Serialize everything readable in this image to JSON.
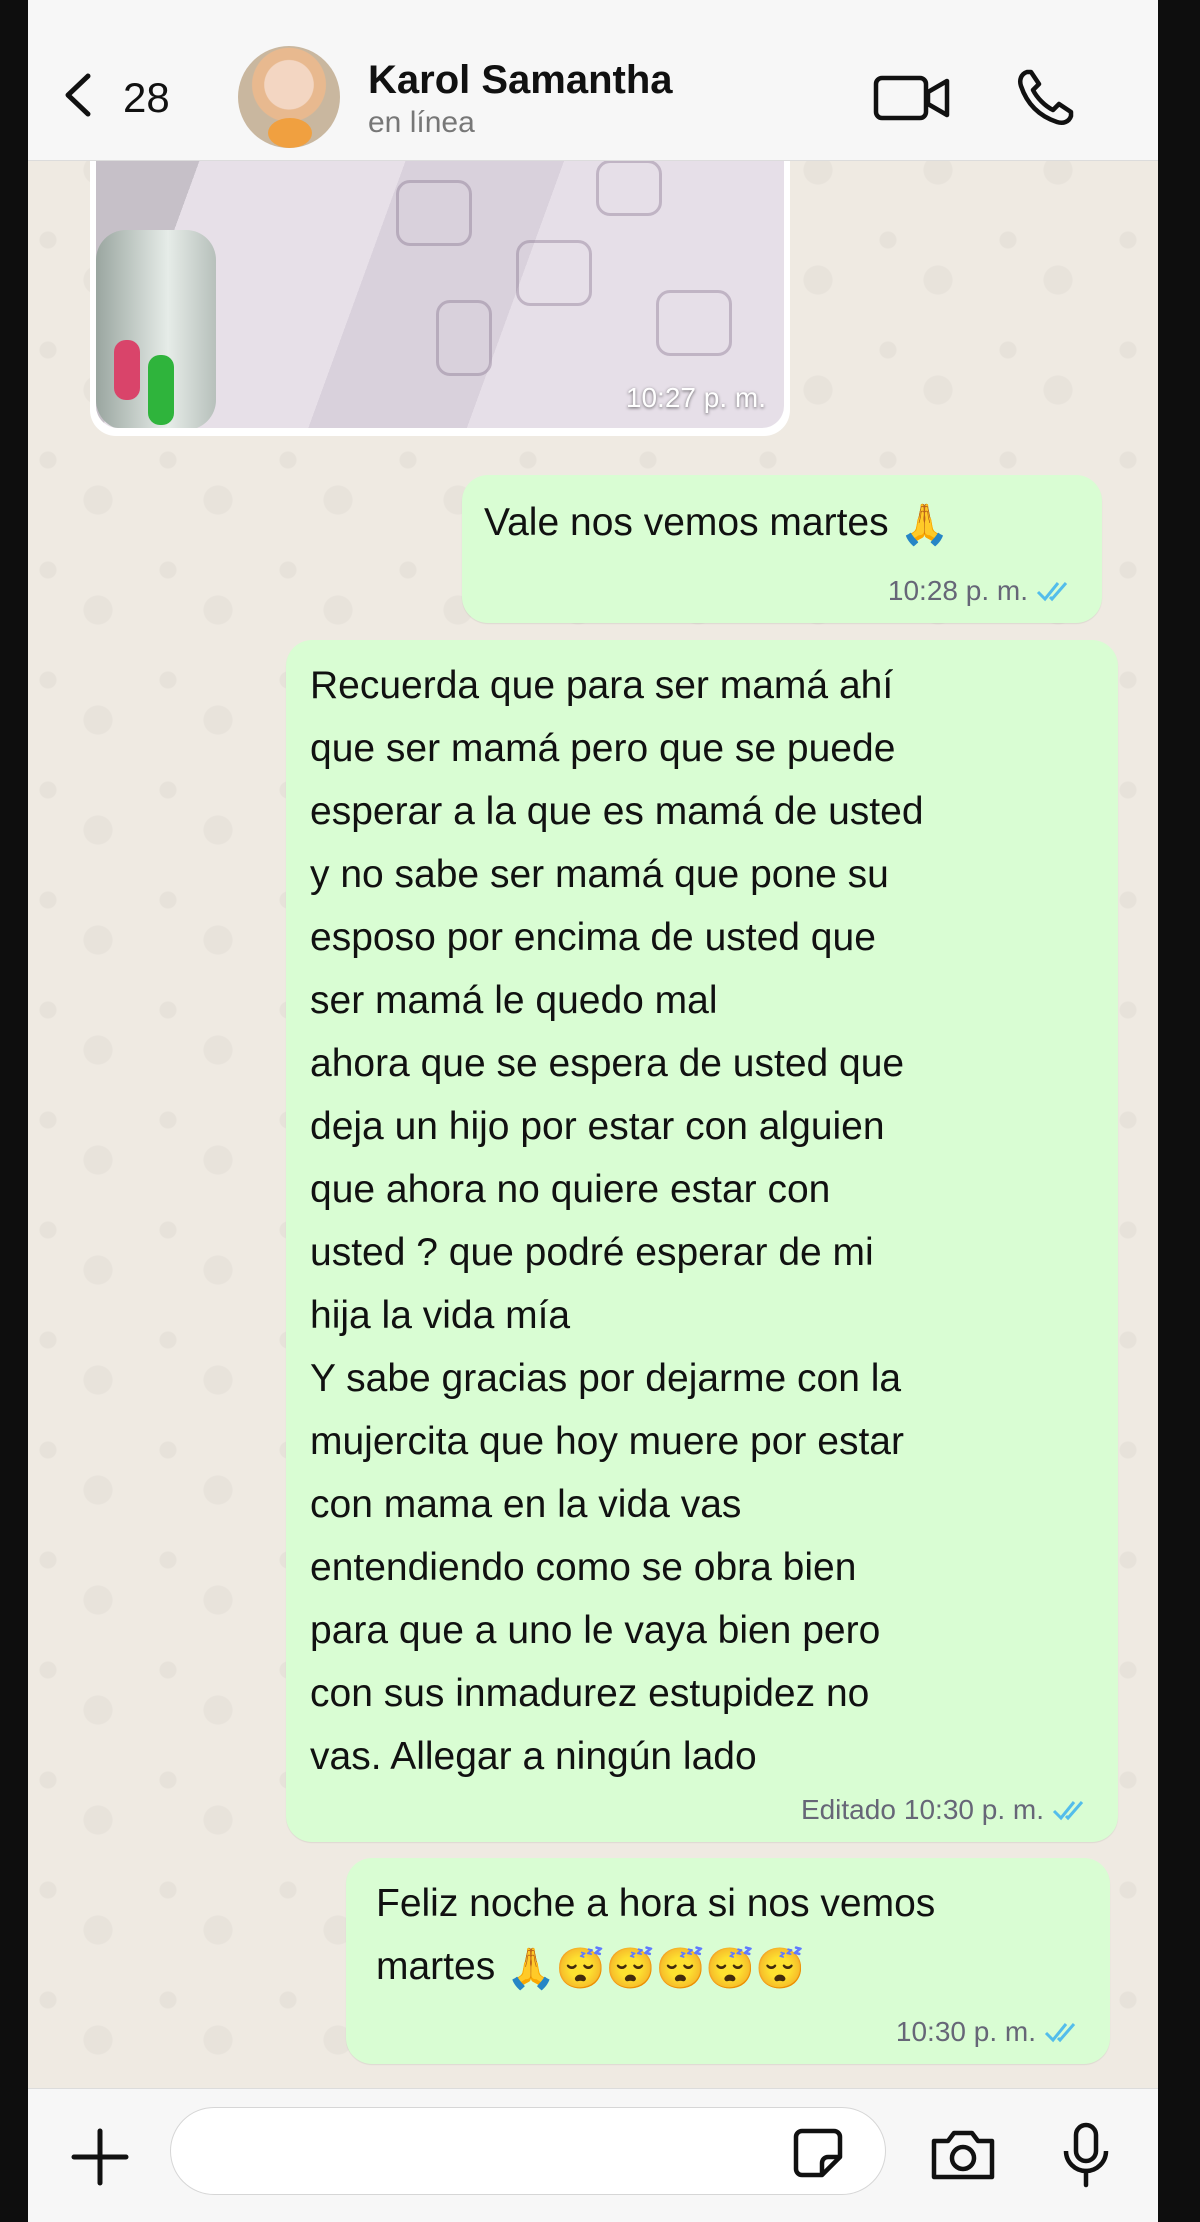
{
  "header": {
    "unread_count": "28",
    "contact_name": "Karol Samantha",
    "contact_status": "en línea"
  },
  "messages": [
    {
      "type": "image",
      "direction": "incoming",
      "time": "10:27 p. m."
    },
    {
      "type": "text",
      "direction": "outgoing",
      "text": "Vale nos vemos martes",
      "emojis": "🙏",
      "time": "10:28 p. m.",
      "status": "read"
    },
    {
      "type": "text",
      "direction": "outgoing",
      "text": "Recuerda que para ser mamá ahí\nque ser mamá pero que se puede\nesperar a la que es mamá de usted\ny no sabe ser mamá que pone su\nesposo por encima de usted que\nser mamá  le quedo mal\nahora que se espera de  usted que\ndeja un hijo por estar con alguien\nque ahora no quiere estar con\nusted ? que podré esperar de mi\nhija la vida mía\nY sabe gracias por dejarme con la\nmujercita que hoy muere por estar\ncon mama en la vida vas\nentendiendo como se obra bien\npara que a uno le vaya bien pero\ncon sus inmadurez estupidez no\nvas. Allegar a ningún lado",
      "edited_label": "Editado",
      "time": "10:30 p. m.",
      "status": "read"
    },
    {
      "type": "text",
      "direction": "outgoing",
      "text": "Feliz noche a hora si nos vemos\nmartes",
      "emojis": "🙏😴😴😴😴😴",
      "time": "10:30 p. m.",
      "status": "read"
    }
  ],
  "composer": {
    "placeholder": ""
  },
  "icons": [
    "back-chevron-icon",
    "video-call-icon",
    "phone-call-icon",
    "plus-icon",
    "sticker-icon",
    "camera-icon",
    "microphone-icon",
    "double-check-icon"
  ],
  "colors": {
    "outgoing_bubble": "#d9fdd3",
    "chat_background": "#efeae2",
    "read_ticks": "#53bdeb"
  }
}
